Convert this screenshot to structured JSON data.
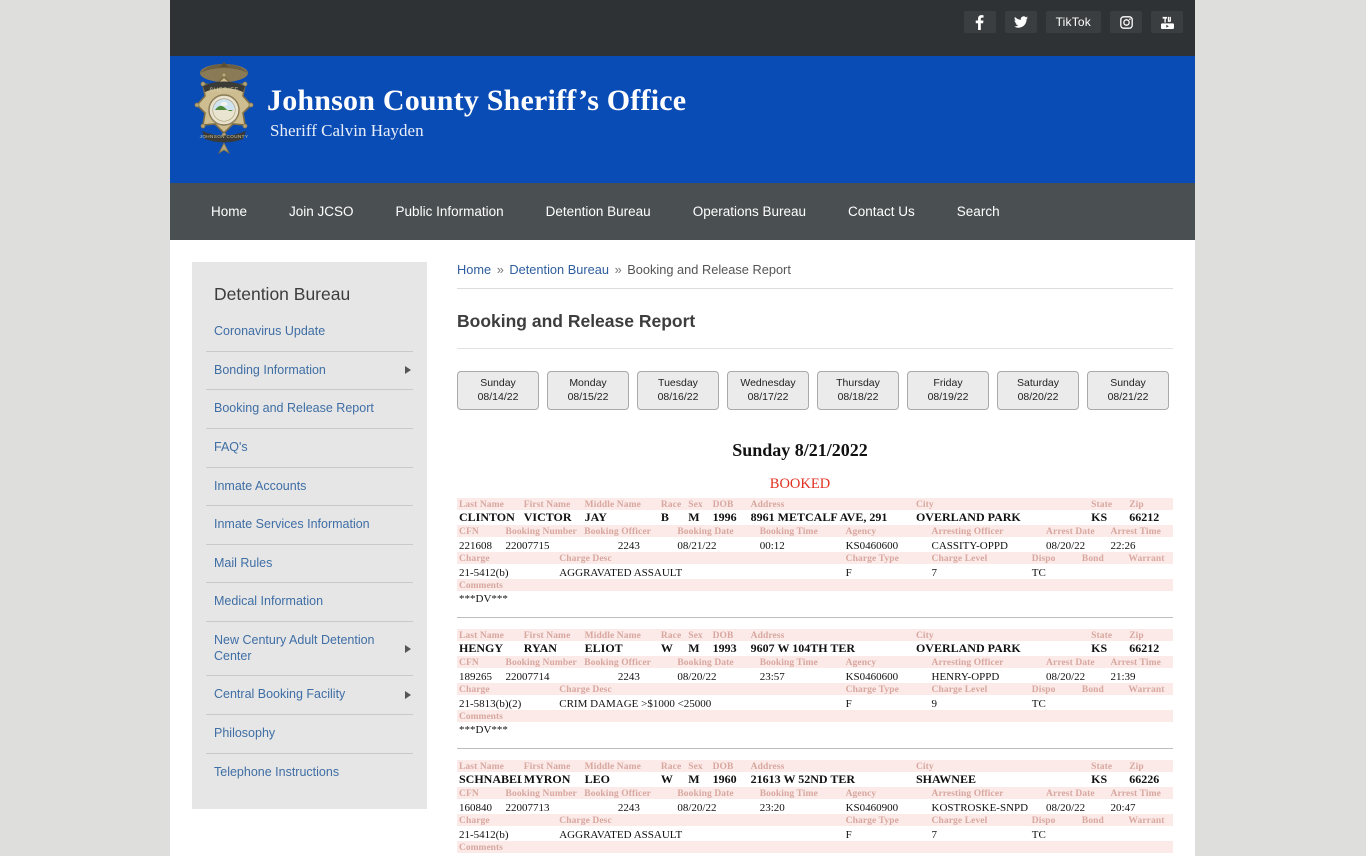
{
  "topbar": {
    "social": [
      {
        "name": "facebook",
        "label": "f"
      },
      {
        "name": "twitter",
        "label": ""
      },
      {
        "name": "tiktok",
        "label": "TikTok"
      },
      {
        "name": "instagram",
        "label": ""
      },
      {
        "name": "youtube",
        "label": ""
      }
    ]
  },
  "banner": {
    "title": "Johnson County Sheriff’s Office",
    "subtitle": "Sheriff Calvin Hayden",
    "bg_color": "#0a4cb5"
  },
  "nav": {
    "items": [
      {
        "label": "Home"
      },
      {
        "label": "Join JCSO"
      },
      {
        "label": "Public Information"
      },
      {
        "label": "Detention Bureau"
      },
      {
        "label": "Operations Bureau"
      },
      {
        "label": "Contact Us"
      },
      {
        "label": "Search"
      }
    ]
  },
  "sidebar": {
    "title": "Detention Bureau",
    "items": [
      {
        "label": "Coronavirus Update",
        "submenu": false
      },
      {
        "label": "Bonding Information",
        "submenu": true
      },
      {
        "label": "Booking and Release Report",
        "submenu": false
      },
      {
        "label": "FAQ's",
        "submenu": false
      },
      {
        "label": "Inmate Accounts",
        "submenu": false
      },
      {
        "label": "Inmate Services Information",
        "submenu": false
      },
      {
        "label": "Mail Rules",
        "submenu": false
      },
      {
        "label": "Medical Information",
        "submenu": false
      },
      {
        "label": "New Century Adult Detention Center",
        "submenu": true
      },
      {
        "label": "Central Booking Facility",
        "submenu": true
      },
      {
        "label": "Philosophy",
        "submenu": false
      },
      {
        "label": "Telephone Instructions",
        "submenu": false
      }
    ]
  },
  "breadcrumb": {
    "home": "Home",
    "section": "Detention Bureau",
    "current": "Booking and Release Report",
    "separator": "»"
  },
  "main": {
    "page_title": "Booking and Release Report",
    "report_date": "Sunday 8/21/2022",
    "booked_heading": "BOOKED",
    "booked_color": "#e03020"
  },
  "day_tabs": [
    {
      "day": "Sunday",
      "date": "08/14/22"
    },
    {
      "day": "Monday",
      "date": "08/15/22"
    },
    {
      "day": "Tuesday",
      "date": "08/16/22"
    },
    {
      "day": "Wednesday",
      "date": "08/17/22"
    },
    {
      "day": "Thursday",
      "date": "08/18/22"
    },
    {
      "day": "Friday",
      "date": "08/19/22"
    },
    {
      "day": "Saturday",
      "date": "08/20/22"
    },
    {
      "day": "Sunday",
      "date": "08/21/22"
    }
  ],
  "table_headers": {
    "row1": [
      "Last Name",
      "First Name",
      "Middle Name",
      "Race",
      "Sex",
      "DOB",
      "Address",
      "City",
      "State",
      "Zip"
    ],
    "row2": [
      "CFN",
      "Booking Number",
      "Booking Officer",
      "Booking Date",
      "Booking Time",
      "Agency",
      "Arresting Officer",
      "Arrest Date",
      "Arrest Time"
    ],
    "row3": [
      "Charge",
      "Charge Desc",
      "Charge Type",
      "Charge Level",
      "Dispo",
      "Bond",
      "Warrant"
    ],
    "row4": "Comments"
  },
  "records": [
    {
      "last_name": "CLINTON",
      "first_name": "VICTOR",
      "middle_name": "JAY",
      "race": "B",
      "sex": "M",
      "dob": "1996",
      "address": "8961 METCALF AVE, 291",
      "city": "OVERLAND PARK",
      "state": "KS",
      "zip": "66212",
      "cfn": "221608",
      "booking_number": "22007715",
      "booking_officer": "2243",
      "booking_date": "08/21/22",
      "booking_time": "00:12",
      "agency": "KS0460600",
      "arresting_officer": "CASSITY-OPPD",
      "arrest_date": "08/20/22",
      "arrest_time": "22:26",
      "charge": "21-5412(b)",
      "charge_desc": "AGGRAVATED ASSAULT",
      "charge_type": "F",
      "charge_level": "7",
      "dispo": "TC",
      "bond": "",
      "warrant": "",
      "comments": "***DV***"
    },
    {
      "last_name": "HENGY",
      "first_name": "RYAN",
      "middle_name": "ELIOT",
      "race": "W",
      "sex": "M",
      "dob": "1993",
      "address": "9607 W 104TH TER",
      "city": "OVERLAND PARK",
      "state": "KS",
      "zip": "66212",
      "cfn": "189265",
      "booking_number": "22007714",
      "booking_officer": "2243",
      "booking_date": "08/20/22",
      "booking_time": "23:57",
      "agency": "KS0460600",
      "arresting_officer": "HENRY-OPPD",
      "arrest_date": "08/20/22",
      "arrest_time": "21:39",
      "charge": "21-5813(b)(2)",
      "charge_desc": "CRIM DAMAGE >$1000 <25000",
      "charge_type": "F",
      "charge_level": "9",
      "dispo": "TC",
      "bond": "",
      "warrant": "",
      "comments": "***DV***"
    },
    {
      "last_name": "SCHNABEL",
      "first_name": "MYRON",
      "middle_name": "LEO",
      "race": "W",
      "sex": "M",
      "dob": "1960",
      "address": "21613 W 52ND TER",
      "city": "SHAWNEE",
      "state": "KS",
      "zip": "66226",
      "cfn": "160840",
      "booking_number": "22007713",
      "booking_officer": "2243",
      "booking_date": "08/20/22",
      "booking_time": "23:20",
      "agency": "KS0460900",
      "arresting_officer": "KOSTROSKE-SNPD",
      "arrest_date": "08/20/22",
      "arrest_time": "20:47",
      "charge": "21-5412(b)",
      "charge_desc": "AGGRAVATED ASSAULT",
      "charge_type": "F",
      "charge_level": "7",
      "dispo": "TC",
      "bond": "",
      "warrant": "",
      "comments": ""
    }
  ]
}
